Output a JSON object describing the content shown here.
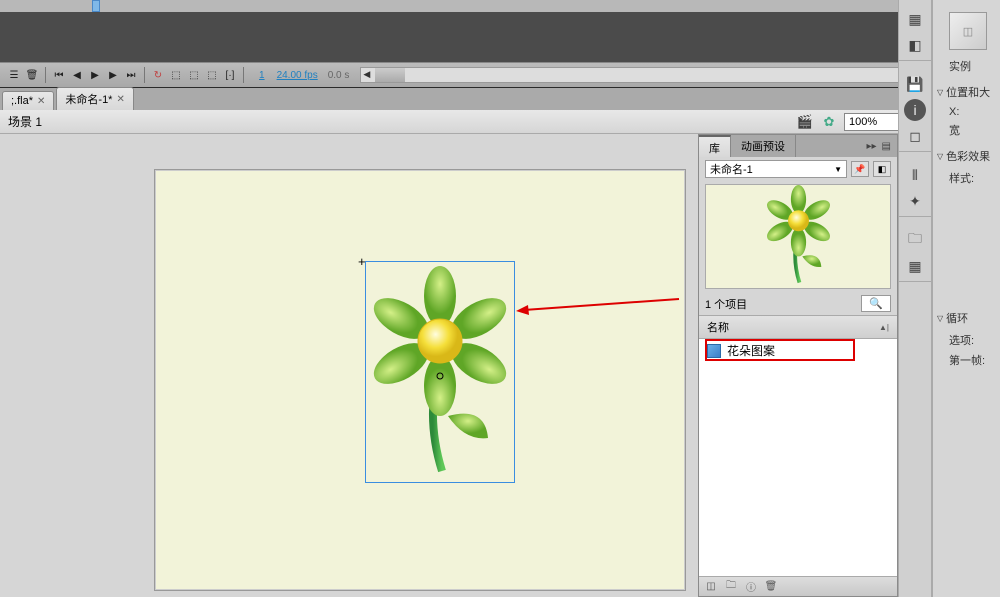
{
  "tabs": {
    "tab1": ";.fla*",
    "tab2": "未命名-1*"
  },
  "scene": {
    "label": "场景 1"
  },
  "zoom": {
    "value": "100%"
  },
  "timeline": {
    "frame_num": "1",
    "fps": "24.00 fps",
    "time": "0.0 s"
  },
  "library": {
    "tab1": "库",
    "tab2": "动画预设",
    "doc_name": "未命名-1",
    "count": "1 个项目",
    "header_name": "名称",
    "item1": "花朵图案"
  },
  "props": {
    "instance": "实例",
    "pos_size": "位置和大",
    "x_label": "X:",
    "width_label": "宽",
    "color_effect": "色彩效果",
    "style_label": "样式:",
    "loop": "循环",
    "options": "选项:",
    "first_frame": "第一帧:"
  },
  "icons": {
    "grid": "▦",
    "box": "◧",
    "save": "💾",
    "info": "ⓘ",
    "crop": "◻",
    "chart": "⫴",
    "globe": "✦",
    "folder": "🗀",
    "trash": "🗑",
    "link": "⧉"
  }
}
